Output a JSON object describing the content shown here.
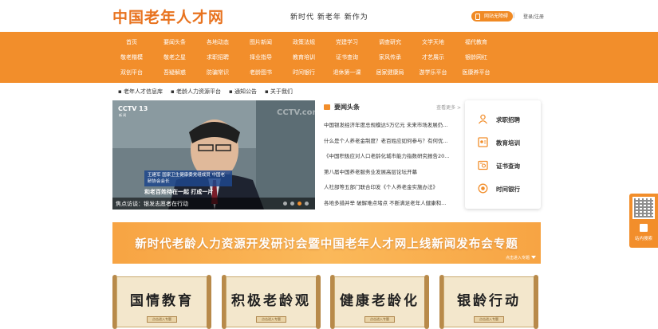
{
  "header": {
    "logo": "中国老年人才网",
    "slogan": "新时代  新老年  新作为",
    "mobile_label": "网站无障碍",
    "login_label": "登录/注册"
  },
  "nav": {
    "items": [
      "首页",
      "要闻头条",
      "各地动态",
      "图片新闻",
      "政策法规",
      "党建学习",
      "调查研究",
      "文学天地",
      "福代教育",
      "",
      "敬老楷模",
      "敬老之星",
      "求职招聘",
      "择业指导",
      "教育培训",
      "证书查询",
      "家风传承",
      "才艺展示",
      "银龄网红",
      "",
      "双创平台",
      "吾疑解惑",
      "防骗常识",
      "老龄图书",
      "时间银行",
      "退休第一课",
      "居家健康局",
      "游学乐平台",
      "医康养平台",
      ""
    ]
  },
  "subnav": {
    "items": [
      "▪ 老年人才信息库",
      "▪ 老龄人力资源平台",
      "▪ 通知公告",
      "▪ 关于我们"
    ]
  },
  "carousel": {
    "channel": "CCTV 13",
    "channel_sub": "新 闻",
    "watermark": "CCTV.com",
    "lower_third": "王建军  国家卫生健康委党组成员 中国老龄协会会长",
    "lower_third2": "和老百姓待在一起 打成一片",
    "caption": "焦点访谈：银发志愿者在行动",
    "dots": 4,
    "active_dot": 3
  },
  "news": {
    "title": "要闻头条",
    "more": "查看更多 >",
    "items": [
      "中国银发经济年度总规模达5万亿元 未来市场发展仍...",
      "什么是个人养老金制度？老百姓应如何参与？有何优...",
      "《中国积极应对人口老龄化城市能力指数研究报告20...",
      "第八届中国养老服务业发展高层论坛开幕",
      "人社部等五部门联合印发《个人养老金实施办法》",
      "各地多措并举 破解难点堵点 不断满足老年人健康和..."
    ]
  },
  "quick_links": {
    "items": [
      "求职招聘",
      "教育培训",
      "证书查询",
      "时间银行"
    ]
  },
  "side_widget": {
    "label": "站内搜索"
  },
  "banner": {
    "text": "新时代老龄人力资源开发研讨会暨中国老年人才网上线新闻发布会专题",
    "sub": "点击进入专题"
  },
  "scrolls": {
    "items": [
      {
        "text": "国情教育",
        "button": "点击进入专题"
      },
      {
        "text": "积极老龄观",
        "button": "点击进入专题"
      },
      {
        "text": "健康老龄化",
        "button": "点击进入专题"
      },
      {
        "text": "银龄行动",
        "button": "点击进入专题"
      }
    ]
  },
  "colors": {
    "brand": "#f28e2b",
    "logo": "#e8731f"
  }
}
